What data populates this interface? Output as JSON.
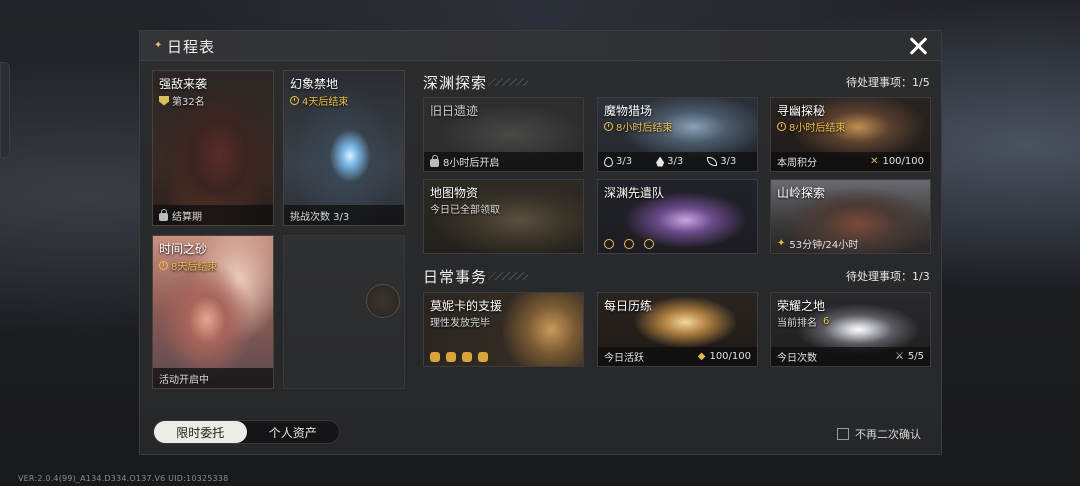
{
  "version_text": "VER:2.0.4(99)_A134.D334.O137.V6   UID:10325338",
  "panel": {
    "title": "日程表"
  },
  "limited": [
    {
      "name": "强敌来袭",
      "sub": "第32名",
      "foot": "结算期"
    },
    {
      "name": "幻象禁地",
      "sub": "4天后结束",
      "foot": "挑战次数 3/3"
    },
    {
      "name": "时间之砂",
      "sub": "8天后结束",
      "foot": "活动开启中"
    }
  ],
  "abyss": {
    "title": "深渊探索",
    "count": "待处理事项：1/5",
    "cards": [
      {
        "name": "旧日遗迹",
        "foot": "8小时后开启"
      },
      {
        "name": "魔物猎场",
        "sub": "8小时后结束",
        "stats": [
          "3/3",
          "3/3",
          "3/3"
        ]
      },
      {
        "name": "寻幽探秘",
        "sub": "8小时后结束",
        "foot": "本周积分",
        "foot_value": "100/100"
      },
      {
        "name": "地图物资",
        "sub": "今日已全部领取"
      },
      {
        "name": "深渊先遣队"
      },
      {
        "name": "山岭探索",
        "foot": "53分钟/24小时"
      }
    ]
  },
  "daily": {
    "title": "日常事务",
    "count": "待处理事项：1/3",
    "cards": [
      {
        "name": "莫妮卡的支援",
        "sub": "理性发放完毕"
      },
      {
        "name": "每日历练",
        "foot": "今日活跃",
        "foot_value": "100/100"
      },
      {
        "name": "荣耀之地",
        "sub_label": "当前排名",
        "sub_value": "6",
        "foot": "今日次数",
        "foot_value": "5/5"
      }
    ]
  },
  "tabs": [
    {
      "label": "限时委托",
      "active": true
    },
    {
      "label": "个人资产",
      "active": false
    }
  ],
  "confirm_label": "不再二次确认",
  "colors": {
    "accent_gold": "#f0c04a",
    "panel_bg": "#2b2c2f",
    "tab_active_bg": "#ecebe6"
  }
}
